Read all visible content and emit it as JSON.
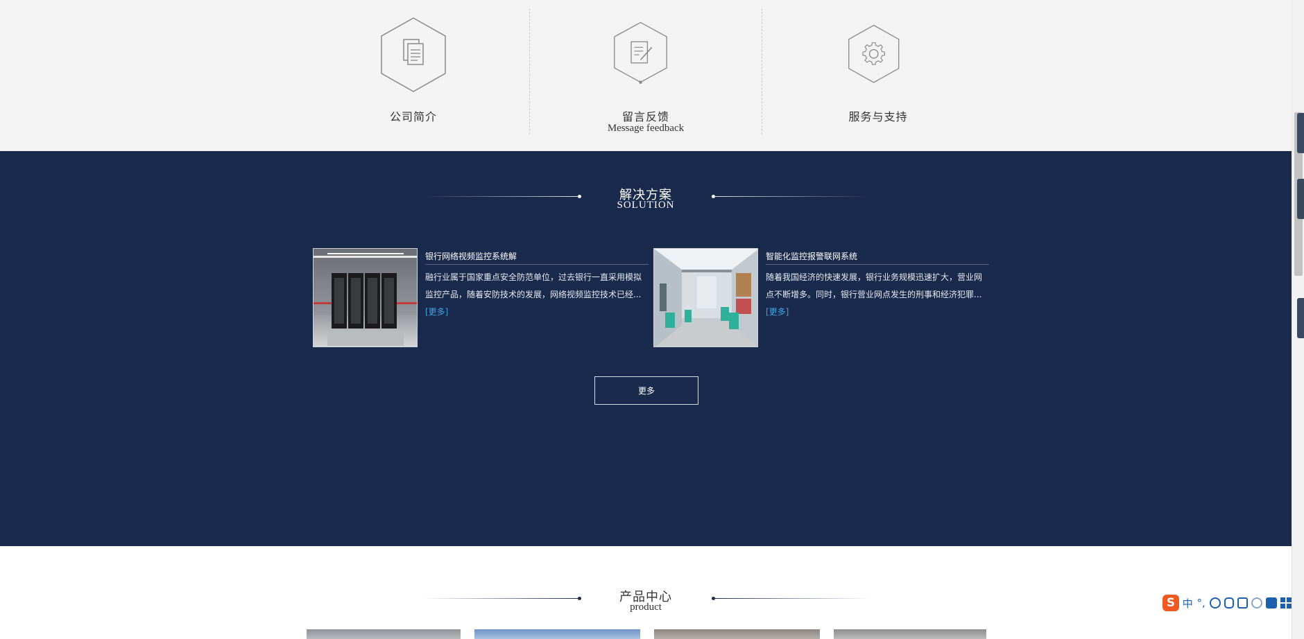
{
  "features": [
    {
      "title": "公司简介",
      "subtitle": "",
      "icon": "document-copy-icon"
    },
    {
      "title": "留言反馈",
      "subtitle": "Message feedback",
      "icon": "edit-note-icon"
    },
    {
      "title": "服务与支持",
      "subtitle": "",
      "icon": "gear-icon"
    }
  ],
  "solution": {
    "title": "解决方案",
    "subtitle": "SOLUTION",
    "cards": [
      {
        "title": "银行网络视频监控系统解",
        "text": "融行业属于国家重点安全防范单位，过去银行一直采用模拟监控产品，随着安防技术的发展，网络视频监控技术已经...",
        "more": "[更多]",
        "image": "server-room-photo"
      },
      {
        "title": "智能化监控报警联网系统",
        "text": "随着我国经济的快速发展，银行业务规模迅速扩大，营业网点不断增多。同时，银行营业网点发生的刑事和经济犯罪...",
        "more": "[更多]",
        "image": "bank-hall-photo"
      }
    ],
    "more_button": "更多"
  },
  "product": {
    "title": "产品中心",
    "subtitle": "product"
  },
  "ime": {
    "logo": "S",
    "lang": "中",
    "punct": "°,"
  },
  "colors": {
    "navy": "#1a2a4c",
    "strip": "#f3f3f3",
    "link": "#3fa5e6",
    "ime_blue": "#1c5fb0",
    "ime_orange": "#f05a22"
  }
}
